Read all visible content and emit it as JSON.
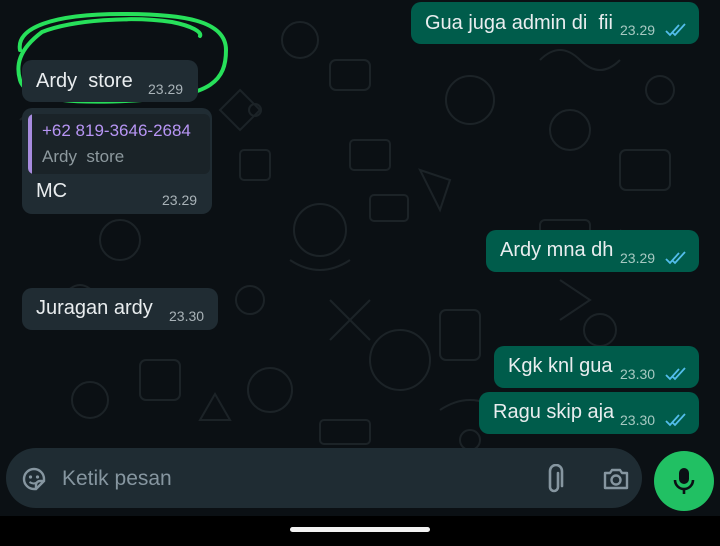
{
  "messages": [
    {
      "id": "m1",
      "direction": "outgoing",
      "text": "Gua juga admin di  fii",
      "time": "23.29",
      "status": "read"
    },
    {
      "id": "m2",
      "direction": "incoming",
      "text": "Ardy  store",
      "time": "23.29",
      "highlighted": true
    },
    {
      "id": "m3",
      "direction": "incoming",
      "quote": {
        "phone": "+62 819-3646-2684",
        "name": "Ardy  store"
      },
      "text": "MC",
      "time": "23.29"
    },
    {
      "id": "m4",
      "direction": "outgoing",
      "text": "Ardy mna dh",
      "time": "23.29",
      "status": "read"
    },
    {
      "id": "m5",
      "direction": "incoming",
      "text": "Juragan ardy",
      "time": "23.30"
    },
    {
      "id": "m6",
      "direction": "outgoing",
      "text": "Kgk knl gua",
      "time": "23.30",
      "status": "read"
    },
    {
      "id": "m7",
      "direction": "outgoing",
      "text": "Ragu skip aja",
      "time": "23.30",
      "status": "read"
    }
  ],
  "composer": {
    "placeholder": "Ketik pesan",
    "sticker_icon": "sticker-icon",
    "attach_icon": "paperclip-icon",
    "camera_icon": "camera-icon",
    "mic_icon": "mic-icon"
  },
  "colors": {
    "background": "#0b1014",
    "incoming_bubble": "#202c33",
    "outgoing_bubble": "#005c4b",
    "read_ticks": "#53bdeb",
    "mic_button": "#21c063",
    "quote_accent": "#a78bde",
    "highlight_marker": "#27e05a"
  }
}
